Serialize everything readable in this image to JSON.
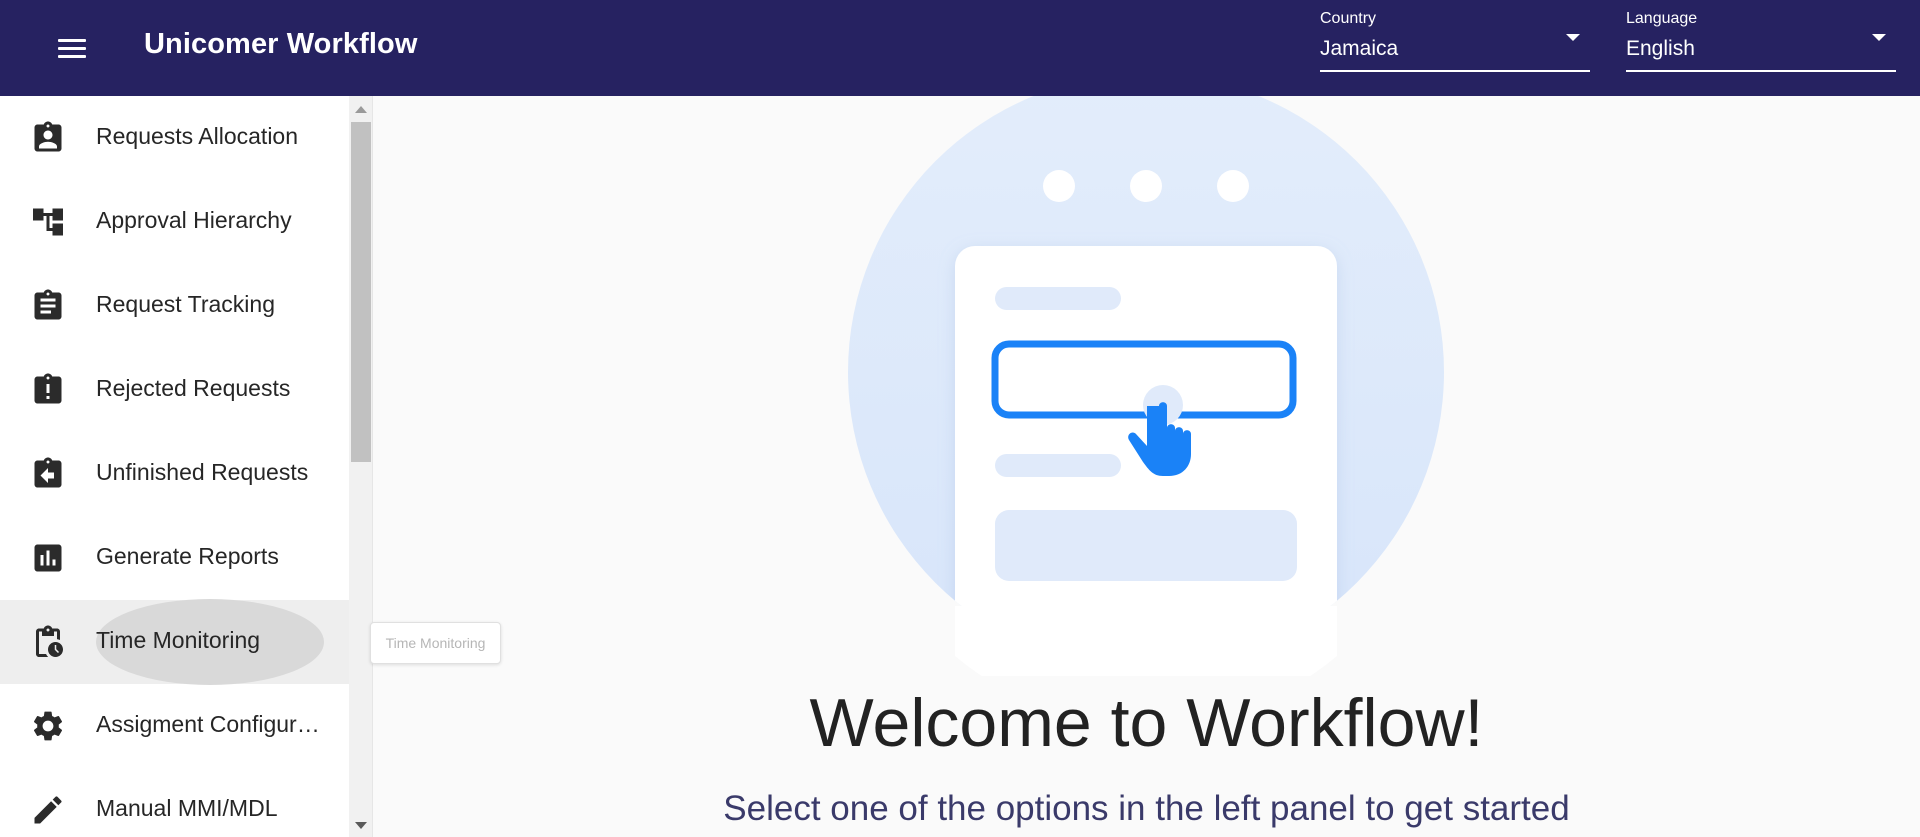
{
  "header": {
    "title": "Unicomer Workflow",
    "menu_icon": "hamburger-menu-icon",
    "country": {
      "label": "Country",
      "value": "Jamaica"
    },
    "language": {
      "label": "Language",
      "value": "English"
    },
    "background_color": "#262261"
  },
  "sidebar": {
    "items": [
      {
        "label": "Requests Allocation",
        "icon": "assignment-ind-icon"
      },
      {
        "label": "Approval Hierarchy",
        "icon": "account-tree-icon"
      },
      {
        "label": "Request Tracking",
        "icon": "assignment-icon"
      },
      {
        "label": "Rejected Requests",
        "icon": "assignment-late-icon"
      },
      {
        "label": "Unfinished Requests",
        "icon": "assignment-return-icon"
      },
      {
        "label": "Generate Reports",
        "icon": "assessment-icon"
      },
      {
        "label": "Time Monitoring",
        "icon": "pending-actions-icon"
      },
      {
        "label": "Assigment Configuration",
        "icon": "settings-icon"
      },
      {
        "label": "Manual MMI/MDL",
        "icon": "edit-icon"
      }
    ],
    "hovered": "Time Monitoring"
  },
  "tooltip": {
    "text": "Time Monitoring"
  },
  "main": {
    "illustration_icon": "form-click-illustration",
    "welcome": "Welcome to Workflow!",
    "subtitle": "Select one of the options in the left panel to get started",
    "accent_color": "#1a82f7"
  }
}
